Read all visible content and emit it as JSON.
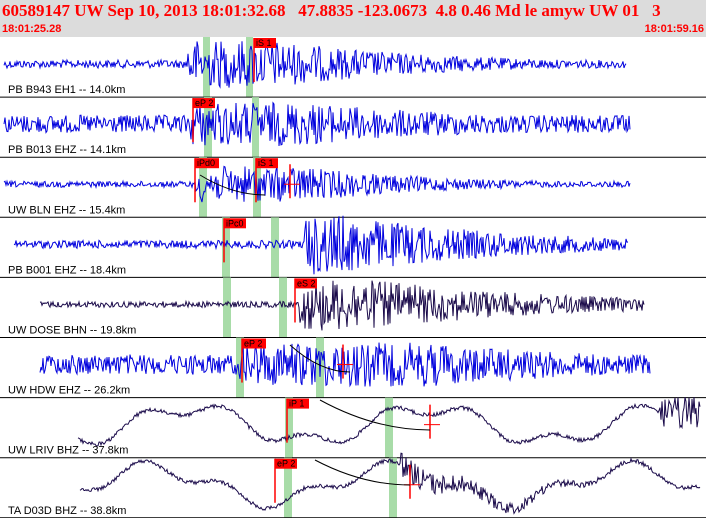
{
  "header": {
    "title": "60589147 UW Sep 10, 2013 18:01:32.68   47.8835 -123.0673  4.8 0.46 Md le amyw UW 01   3",
    "start_time": "18:01:25.28",
    "end_time": "18:01:59.16"
  },
  "colors": {
    "trace_blue": "#0000dd",
    "trace_dark": "#1a0a4a",
    "pick_red": "#ff0000",
    "window_green": "#a8dca8",
    "header_bg": "#dcdcdc"
  },
  "traces": [
    {
      "label": "PB B943 EH1 -- 14.0km",
      "color": "blue",
      "picks": [
        {
          "label": "iS 1"
        }
      ],
      "windows": 2
    },
    {
      "label": "PB B013 EHZ -- 14.1km",
      "color": "blue",
      "picks": [
        {
          "label": "eP 2"
        }
      ],
      "windows": 2
    },
    {
      "label": "UW BLN EHZ -- 15.4km",
      "color": "blue",
      "picks": [
        {
          "label": "iPd0"
        },
        {
          "label": "iS 1"
        }
      ],
      "windows": 2
    },
    {
      "label": "PB B001 EHZ -- 18.4km",
      "color": "blue",
      "picks": [
        {
          "label": "iPc0"
        }
      ],
      "windows": 2
    },
    {
      "label": "UW DOSE BHN -- 19.8km",
      "color": "dark",
      "picks": [
        {
          "label": "eS 2"
        }
      ],
      "windows": 2
    },
    {
      "label": "UW HDW EHZ -- 26.2km",
      "color": "blue",
      "picks": [
        {
          "label": "eP 2"
        }
      ],
      "windows": 2
    },
    {
      "label": "UW LRIV BHZ -- 37.8km",
      "color": "dark",
      "picks": [
        {
          "label": "iP 1"
        }
      ],
      "windows": 2
    },
    {
      "label": "TA D03D BHZ -- 38.8km",
      "color": "dark",
      "picks": [
        {
          "label": "eP 2"
        }
      ],
      "windows": 2
    }
  ]
}
